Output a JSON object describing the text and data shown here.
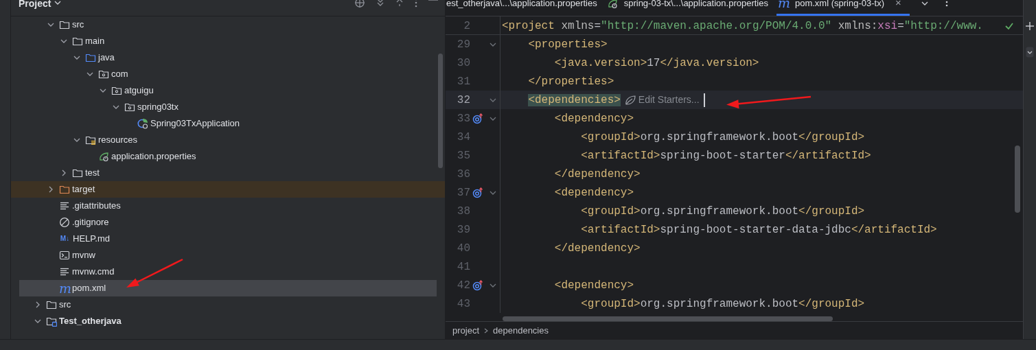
{
  "project_panel": {
    "title": "Project",
    "tree": [
      {
        "children": [
          {
            "label": "src",
            "kind": "folder",
            "expanded": true,
            "selected": false,
            "children": [
              {
                "label": "main",
                "kind": "folder",
                "expanded": true,
                "selected": false,
                "children": [
                  {
                    "label": "java",
                    "kind": "source_root",
                    "expanded": true,
                    "selected": false,
                    "children": [
                      {
                        "label": "com",
                        "kind": "package",
                        "expanded": true,
                        "selected": false,
                        "children": [
                          {
                            "label": "atguigu",
                            "kind": "package",
                            "expanded": true,
                            "selected": false,
                            "children": [
                              {
                                "label": "spring03tx",
                                "kind": "package",
                                "expanded": true,
                                "selected": false,
                                "children": [
                                  {
                                    "label": "Spring03TxApplication",
                                    "kind": "spring_class",
                                    "selected": false
                                  }
                                ]
                              }
                            ]
                          }
                        ]
                      }
                    ]
                  },
                  {
                    "label": "resources",
                    "kind": "resources",
                    "expanded": true,
                    "selected": false,
                    "children": [
                      {
                        "label": "application.properties",
                        "kind": "spring_config",
                        "selected": false
                      }
                    ]
                  }
                ]
              },
              {
                "label": "test",
                "kind": "folder",
                "expanded": false,
                "selected": false
              }
            ]
          },
          {
            "label": "target",
            "kind": "excluded",
            "expanded": false,
            "selected": false
          },
          {
            "label": ".gitattributes",
            "kind": "text",
            "selected": false
          },
          {
            "label": ".gitignore",
            "kind": "ignore",
            "selected": false
          },
          {
            "label": "HELP.md",
            "kind": "markdown",
            "icon_text": "M↓",
            "selected": false
          },
          {
            "label": "mvnw",
            "kind": "shell",
            "selected": false
          },
          {
            "label": "mvnw.cmd",
            "kind": "text",
            "selected": false
          },
          {
            "label": "pom.xml",
            "kind": "maven",
            "icon_text": "m",
            "selected": true
          }
        ]
      },
      {
        "label": "src",
        "kind": "folder",
        "expanded": false,
        "selected": false
      },
      {
        "label": "Test_otherjava",
        "kind": "module",
        "expanded": true,
        "selected": false
      }
    ]
  },
  "editor": {
    "tabs": [
      {
        "label": "est_otherjava\\...\\application.properties",
        "kind": "plain",
        "selected": false
      },
      {
        "label": "spring-03-tx\\...\\application.properties",
        "kind": "spring_config",
        "selected": false
      },
      {
        "label": "pom.xml (spring-03-tx)",
        "kind": "maven",
        "icon_text": "m",
        "close": "×",
        "selected": true
      }
    ],
    "sticky_line": {
      "number": "2",
      "tokens": [
        {
          "text": "<project",
          "kind": "tag"
        },
        {
          "text": " xmlns",
          "kind": "attr"
        },
        {
          "text": "=",
          "kind": "text"
        },
        {
          "text": "\"http://maven.apache.org/POM/4.0.0\"",
          "kind": "value"
        },
        {
          "text": " xmlns:",
          "kind": "attr"
        },
        {
          "text": "xsi",
          "kind": "ns"
        },
        {
          "text": "=",
          "kind": "text"
        },
        {
          "text": "\"http://www.",
          "kind": "value"
        }
      ]
    },
    "lines": [
      {
        "number": "29",
        "foldable": true,
        "gutter_icon": false,
        "current": false,
        "tokens": [
          {
            "text": "    <properties>",
            "kind": "tag"
          }
        ]
      },
      {
        "number": "30",
        "foldable": false,
        "gutter_icon": false,
        "current": false,
        "tokens": [
          {
            "text": "        <java.version>",
            "kind": "tag"
          },
          {
            "text": "17",
            "kind": "text"
          },
          {
            "text": "</java.version>",
            "kind": "tag"
          }
        ]
      },
      {
        "number": "31",
        "foldable": false,
        "gutter_icon": false,
        "current": false,
        "tokens": [
          {
            "text": "    </properties>",
            "kind": "tag"
          }
        ]
      },
      {
        "number": "32",
        "foldable": true,
        "gutter_icon": false,
        "current": true,
        "hint": "Edit Starters...",
        "tokens": [
          {
            "text": "    <dependencies>",
            "kind": "tag",
            "matched": true
          }
        ]
      },
      {
        "number": "33",
        "foldable": true,
        "gutter_icon": true,
        "current": false,
        "tokens": [
          {
            "text": "        <dependency>",
            "kind": "tag"
          }
        ]
      },
      {
        "number": "34",
        "foldable": false,
        "gutter_icon": false,
        "current": false,
        "tokens": [
          {
            "text": "            <groupId>",
            "kind": "tag"
          },
          {
            "text": "org.springframework.boot",
            "kind": "text"
          },
          {
            "text": "</groupId>",
            "kind": "tag"
          }
        ]
      },
      {
        "number": "35",
        "foldable": false,
        "gutter_icon": false,
        "current": false,
        "tokens": [
          {
            "text": "            <artifactId>",
            "kind": "tag"
          },
          {
            "text": "spring-boot-starter",
            "kind": "text"
          },
          {
            "text": "</artifactId>",
            "kind": "tag"
          }
        ]
      },
      {
        "number": "36",
        "foldable": false,
        "gutter_icon": false,
        "current": false,
        "tokens": [
          {
            "text": "        </dependency>",
            "kind": "tag"
          }
        ]
      },
      {
        "number": "37",
        "foldable": true,
        "gutter_icon": true,
        "current": false,
        "tokens": [
          {
            "text": "        <dependency>",
            "kind": "tag"
          }
        ]
      },
      {
        "number": "38",
        "foldable": false,
        "gutter_icon": false,
        "current": false,
        "tokens": [
          {
            "text": "            <groupId>",
            "kind": "tag"
          },
          {
            "text": "org.springframework.boot",
            "kind": "text"
          },
          {
            "text": "</groupId>",
            "kind": "tag"
          }
        ]
      },
      {
        "number": "39",
        "foldable": false,
        "gutter_icon": false,
        "current": false,
        "tokens": [
          {
            "text": "            <artifactId>",
            "kind": "tag"
          },
          {
            "text": "spring-boot-starter-data-jdbc",
            "kind": "text"
          },
          {
            "text": "</artifactId>",
            "kind": "tag"
          }
        ]
      },
      {
        "number": "40",
        "foldable": false,
        "gutter_icon": false,
        "current": false,
        "tokens": [
          {
            "text": "        </dependency>",
            "kind": "tag"
          }
        ]
      },
      {
        "number": "41",
        "foldable": false,
        "gutter_icon": false,
        "current": false
      },
      {
        "number": "42",
        "foldable": true,
        "gutter_icon": true,
        "current": false,
        "tokens": [
          {
            "text": "        <dependency>",
            "kind": "tag"
          }
        ]
      },
      {
        "number": "43",
        "foldable": false,
        "gutter_icon": false,
        "current": false,
        "tokens": [
          {
            "text": "            <groupId>",
            "kind": "tag"
          },
          {
            "text": "org.springframework.boot",
            "kind": "text"
          },
          {
            "text": "</groupId>",
            "kind": "tag"
          }
        ]
      }
    ],
    "breadcrumbs": [
      "project",
      "dependencies"
    ]
  }
}
